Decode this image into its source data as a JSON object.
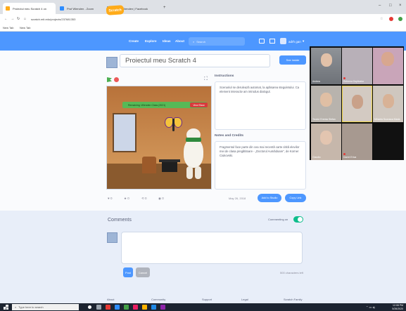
{
  "browser": {
    "tabs": [
      {
        "label": "Proiectul meu Scratch 4 on",
        "color": "#ffab19",
        "active": true
      },
      {
        "label": "Prof Wienden - Zoom",
        "color": "#2d8cff",
        "active": false
      },
      {
        "label": "Clase Wienden | Facebook",
        "color": "#1877f2",
        "active": false
      }
    ],
    "new_tab": "+",
    "url": "scratch.mit.edu/projects/237681353",
    "bookmarks": [
      "New Tab",
      "New Tab"
    ]
  },
  "nav": {
    "logo": "Scratch",
    "items": [
      "Create",
      "Explore",
      "Ideas",
      "About"
    ],
    "search_placeholder": "Search",
    "username": "adrh gan"
  },
  "project": {
    "title": "Proiectul meu Scratch 4",
    "see_inside": "See inside",
    "stage_banner": "Remaining: Wienden Class (2021)",
    "stage_btn": "View Show",
    "instructions_heading": "Instructions",
    "instructions_text": "Scenariul se derulează automat, la apăsarea steguletului. Ca element interactiv am introdus dialogul.",
    "notes_heading": "Notes and Credits",
    "notes_text": "Fragmentul face parte din cea mai recentă carte citită elevilor mei de clasa pregătitoare - „Doctorul Aumădoare”, de Korner Ciukovski.",
    "stats": {
      "loves": "0",
      "favorites": "0",
      "remixes": "0",
      "views": "0"
    },
    "date": "May 26, 2018",
    "add_studio": "Add to Studio",
    "copy_link": "Copy Link"
  },
  "video": {
    "participants": [
      {
        "name": "Andrea",
        "bg": "#8a8d92",
        "muted": false
      },
      {
        "name": "Reforma Duplicator",
        "bg": "#c9a5b9",
        "muted": true
      },
      {
        "name": "Teodor Eremia Stefan",
        "bg": "#b8b3ad",
        "muted": false
      },
      {
        "name": "Mihaela Scurusca Maria",
        "bg": "#d3cac2",
        "muted": false
      },
      {
        "name": "Claudiu",
        "bg": "#c6b7ab",
        "muted": false
      },
      {
        "name": "Daniel Erica",
        "bg": "#a79990",
        "muted": true
      }
    ]
  },
  "comments": {
    "heading": "Comments",
    "commenting_label": "Commenting on",
    "post": "Post",
    "cancel": "Cancel",
    "chars_left": "500 characters left"
  },
  "footer": [
    "About",
    "Community",
    "Support",
    "Legal",
    "Scratch Family"
  ],
  "taskbar": {
    "search_placeholder": "Type here to search",
    "time": "12:08 PM",
    "date": "5/26/2020"
  },
  "colors": {
    "accent": "#4d97ff",
    "scratch_orange": "#ffab19",
    "toggle_on": "#0fbd8c"
  }
}
